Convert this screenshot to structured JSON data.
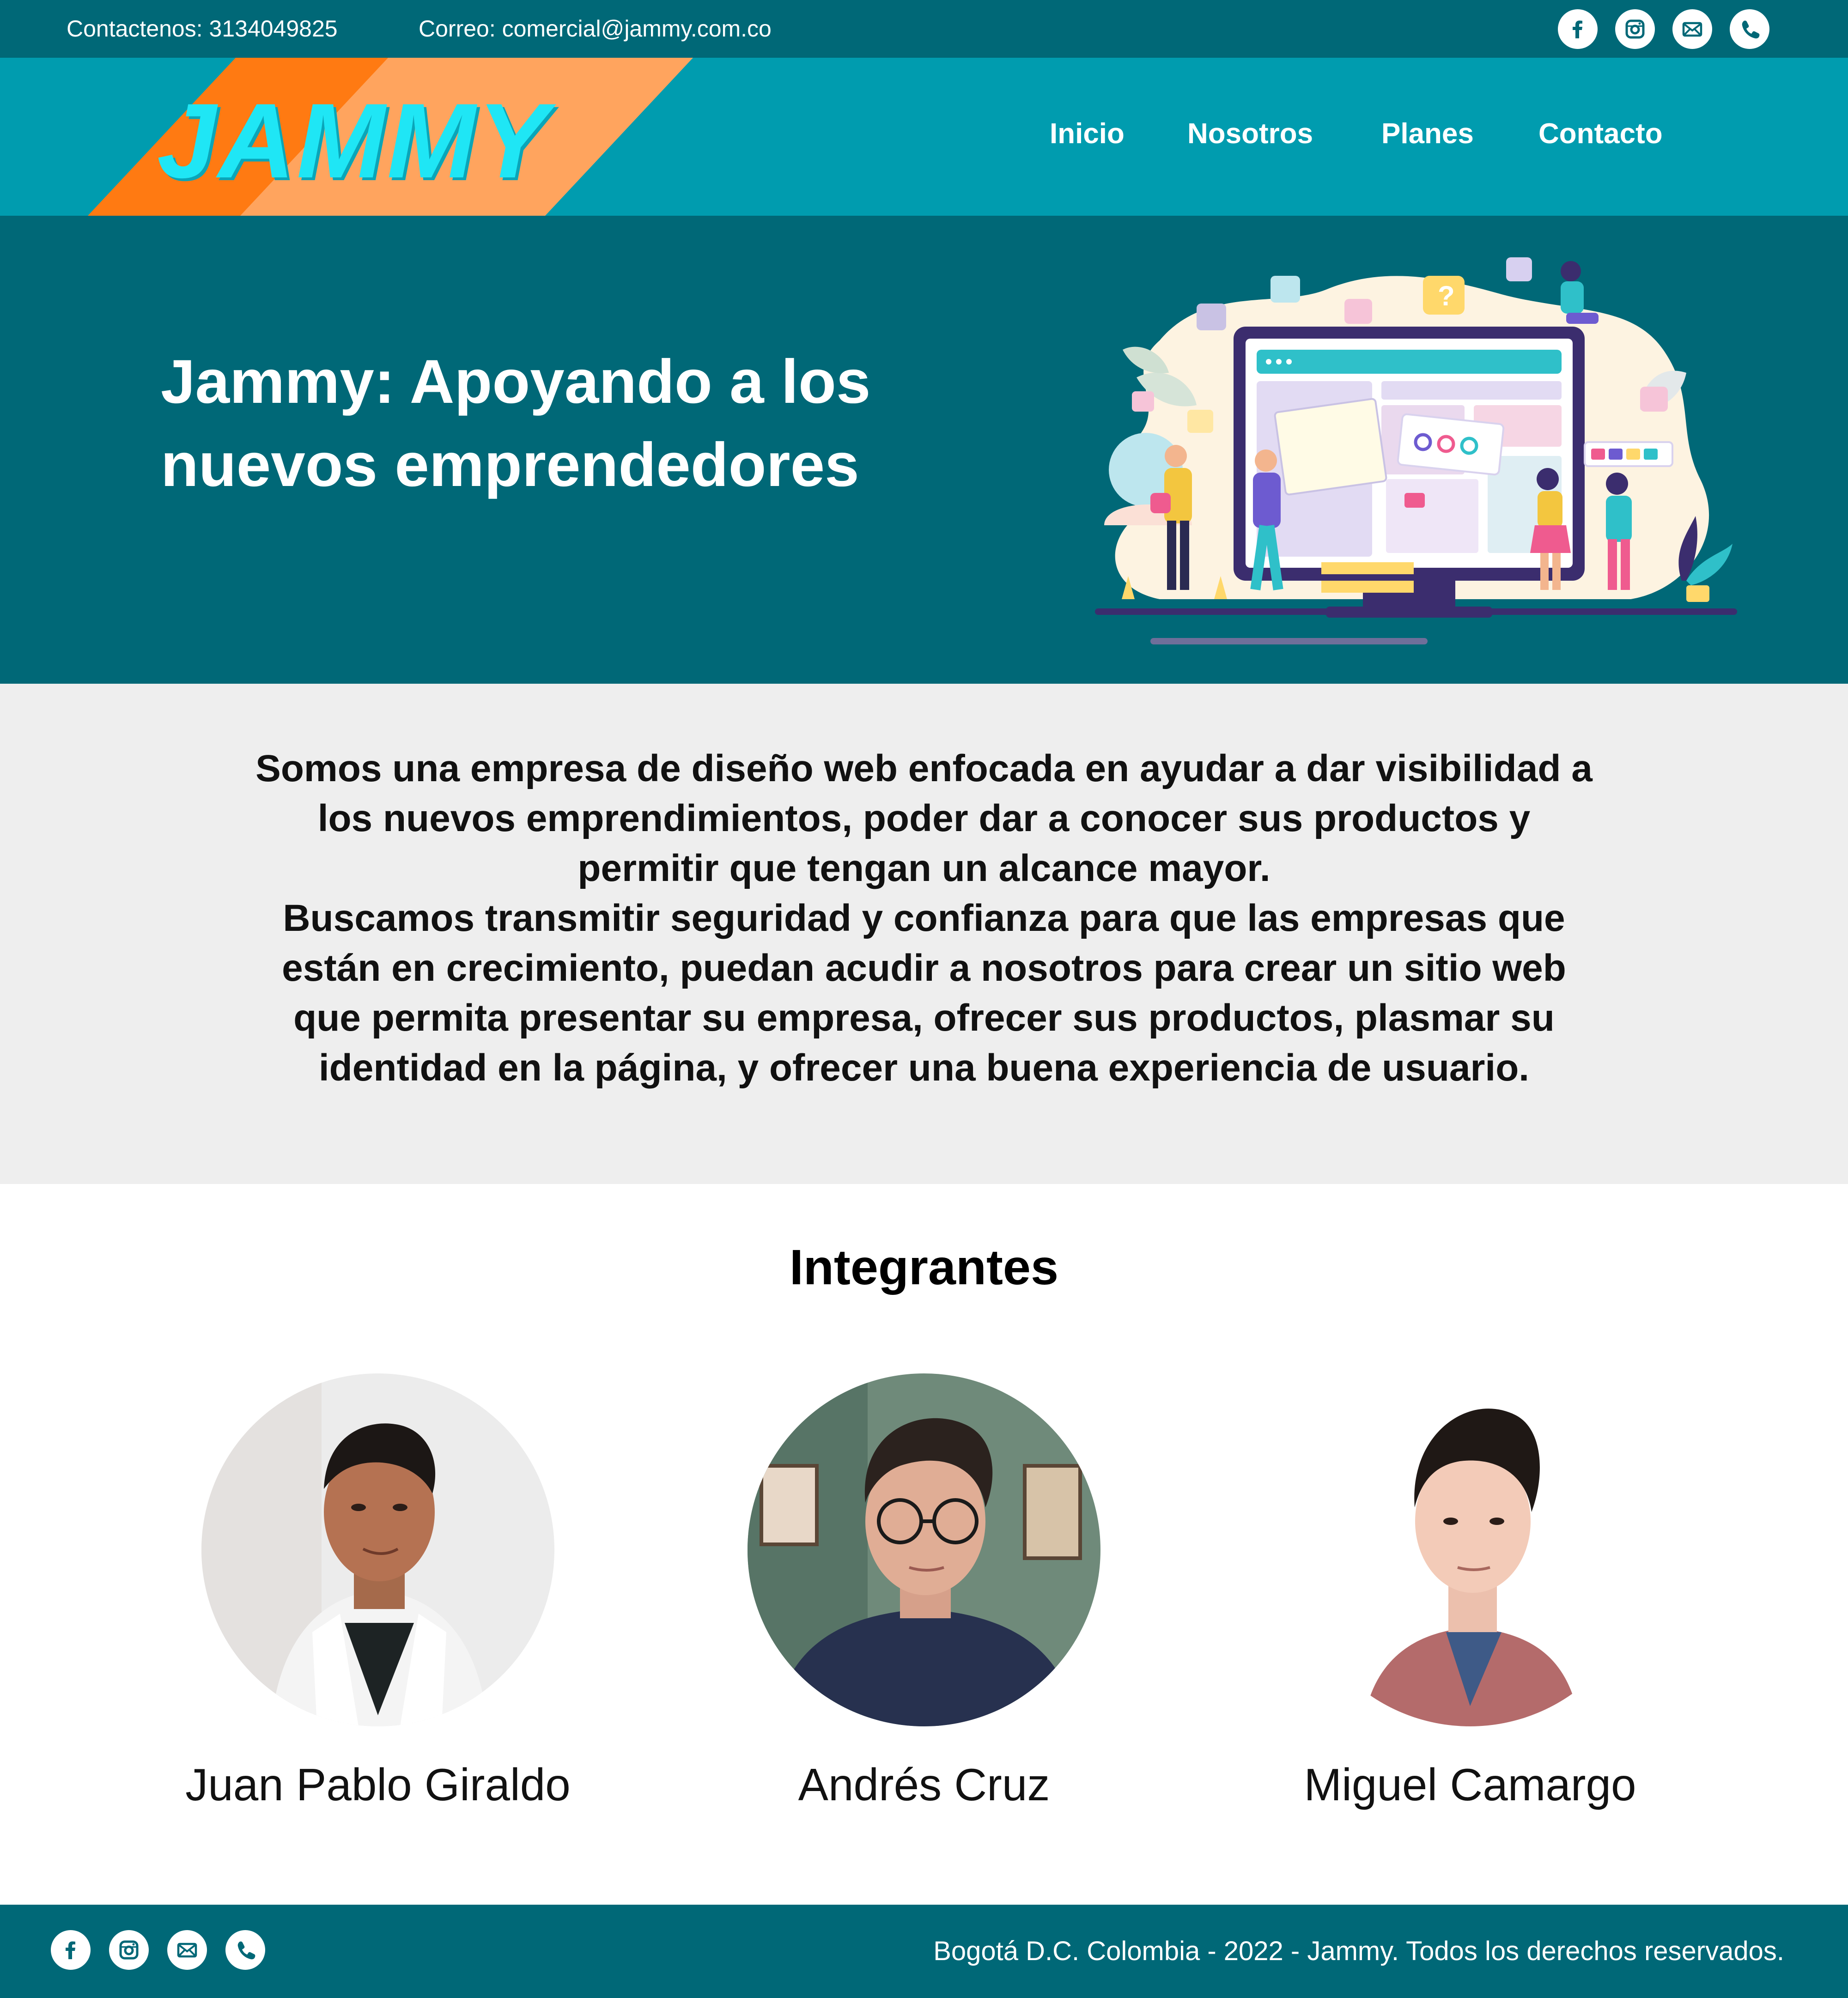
{
  "topbar": {
    "phone_text": "Contactenos: 3134049825",
    "email_text": "Correo: comercial@jammy.com.co",
    "social_icons": [
      "facebook-icon",
      "instagram-icon",
      "mail-icon",
      "phone-icon"
    ]
  },
  "brand": {
    "logo_text": "JAMMY",
    "colors": {
      "dark_teal": "#006877",
      "teal": "#009caf",
      "orange": "#ff7a12",
      "light_orange": "#ffa45e",
      "cyan": "#1fe6f5"
    }
  },
  "nav": {
    "items": [
      "Inicio",
      "Nosotros",
      "Planes",
      "Contacto"
    ]
  },
  "hero": {
    "title_line1": "Jammy: Apoyando a los",
    "title_line2": "nuevos emprendedores"
  },
  "about": {
    "paragraph1": "Somos una empresa de diseño web enfocada en ayudar a dar visibilidad a los nuevos emprendimientos, poder dar a conocer sus productos y permitir que tengan un alcance mayor.",
    "paragraph2": "Buscamos transmitir seguridad y confianza para que las empresas que están en crecimiento, puedan acudir a nosotros para crear un sitio web que permita presentar su empresa, ofrecer sus productos, plasmar su identidad en la página, y ofrecer una buena experiencia de usuario."
  },
  "members": {
    "heading": "Integrantes",
    "list": [
      {
        "name": "Juan Pablo Giraldo"
      },
      {
        "name": "Andrés Cruz"
      },
      {
        "name": "Miguel Camargo"
      }
    ]
  },
  "footer": {
    "copyright": "Bogotá D.C. Colombia - 2022 - Jammy. Todos los derechos reservados.",
    "social_icons": [
      "facebook-icon",
      "instagram-icon",
      "mail-icon",
      "phone-icon"
    ]
  }
}
